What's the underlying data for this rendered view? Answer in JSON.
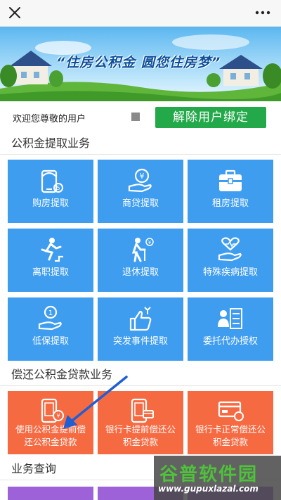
{
  "banner": {
    "slogan": "“住房公积金  圆您住房梦”"
  },
  "user": {
    "welcome_text": "欢迎您尊敬的用户",
    "unbind_label": "解除用户绑定"
  },
  "sections": {
    "withdraw": {
      "title": "公积金提取业务",
      "tiles": [
        {
          "label": "购房提取",
          "icon": "phone-house-icon"
        },
        {
          "label": "商贷提取",
          "icon": "yuan-hand-icon"
        },
        {
          "label": "租房提取",
          "icon": "briefcase-icon"
        },
        {
          "label": "离职提取",
          "icon": "running-person-icon"
        },
        {
          "label": "退休提取",
          "icon": "elderly-cane-icon"
        },
        {
          "label": "特殊疾病提取",
          "icon": "heart-hand-icon"
        },
        {
          "label": "低保提取",
          "icon": "coin-hand-icon"
        },
        {
          "label": "突发事件提取",
          "icon": "thumbs-up-wrench-icon"
        },
        {
          "label": "委托代办授权",
          "icon": "person-list-icon"
        }
      ]
    },
    "repay": {
      "title": "偿还公积金贷款业务",
      "tiles": [
        {
          "label": "使用公积金提前偿还公积金贷款",
          "line1": "使用公积金提前偿",
          "line2": "还公积金贷款",
          "icon": "phone-coin-icon"
        },
        {
          "label": "银行卡提前偿还公积金贷款",
          "line1": "银行卡提前偿还公",
          "line2": "积金贷款",
          "icon": "phone-card-icon"
        },
        {
          "label": "银行卡正常偿还公积金贷款",
          "line1": "银行卡正常偿还公",
          "line2": "积金贷款",
          "icon": "bank-card-icon"
        }
      ]
    },
    "query": {
      "title": "业务查询"
    }
  },
  "watermark": {
    "brand": "谷普软件园",
    "url": "www.gupuxlazal.com"
  },
  "colors": {
    "tile_blue": "#3f9df0",
    "tile_orange": "#f66a42",
    "tile_purple": "#9d62d8",
    "button_green": "#23a94a",
    "arrow_blue": "#1f5fd1"
  }
}
